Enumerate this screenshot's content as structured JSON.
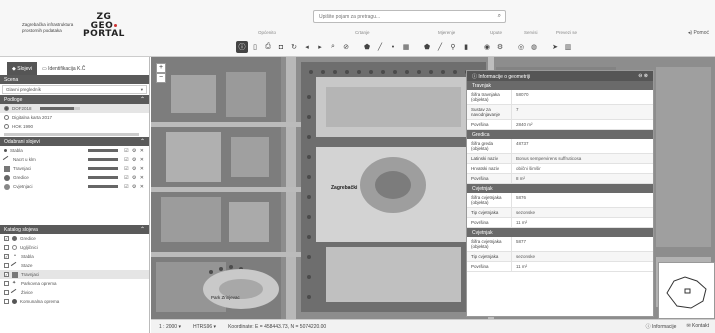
{
  "header": {
    "org_name": "Zagrebačka infrastruktura prostornih podataka",
    "logo_lines": [
      "ZG",
      "GEO",
      "PORTAL"
    ],
    "search_placeholder": "Upišite pojam za pretragu...",
    "toolbar_groups": [
      "Općenito",
      "Crtanje",
      "Mjerenje",
      "Upute",
      "Servisi",
      "Prevezi se"
    ],
    "help_label": "Pomoć"
  },
  "sidebar": {
    "tabs": [
      "Slojevi",
      "Identifikacija K.Č"
    ],
    "scale_section_title": "Scena",
    "scale_value": "Glavni pregledník",
    "basemap_section_title": "Podloge",
    "basemaps": [
      {
        "label": "DOF2018",
        "selected": true
      },
      {
        "label": "Digitalna karta 2017",
        "selected": false
      },
      {
        "label": "HOK 1990",
        "selected": false
      }
    ],
    "active_layers_title": "Odabrani slojevi",
    "active_layers": [
      {
        "label": "Stabla"
      },
      {
        "label": "Nacrt u klm"
      },
      {
        "label": "Travnjaci"
      },
      {
        "label": "Gredice"
      },
      {
        "label": "Cvjetnjaci"
      }
    ],
    "catalog_title": "Katalog slojeva",
    "catalog": [
      {
        "label": "Gredice",
        "checked": true
      },
      {
        "label": "Ugljičnici",
        "checked": false
      },
      {
        "label": "Stabla",
        "checked": true
      },
      {
        "label": "Staze",
        "checked": false
      },
      {
        "label": "Travnjaci",
        "checked": true
      },
      {
        "label": "Parkovna oprema",
        "checked": false
      },
      {
        "label": "Živice",
        "checked": false
      },
      {
        "label": "Komunalna oprema",
        "checked": false
      }
    ]
  },
  "map": {
    "labels": [
      "Zagrebački",
      "Park Zrinjevac"
    ]
  },
  "statusbar": {
    "scale": "1 : 2000",
    "crs": "HTRS96",
    "coords": "Koordinate: E = 458443.73, N = 5074220.00",
    "info": "Informacije",
    "contact": "Kontakt"
  },
  "info_panel": {
    "title": "Informacije o geometriji",
    "groups": [
      {
        "layer": "Travnjak",
        "rows": [
          {
            "k": "Šifra travnjaka (objekta)",
            "v": "58070"
          },
          {
            "k": "Sustav za navodnjavanje",
            "v": "7"
          },
          {
            "k": "Površina",
            "v": "2840 m²"
          }
        ]
      },
      {
        "layer": "Gredica",
        "rows": [
          {
            "k": "Šifra greda (objekta)",
            "v": "48737"
          },
          {
            "k": "Latinski naziv",
            "v": "Bonus sempervirens suffruticosa"
          },
          {
            "k": "Hrvatski naziv",
            "v": "obični šimšir"
          },
          {
            "k": "Površina",
            "v": "8 m²"
          }
        ]
      },
      {
        "layer": "Cvjetnjak",
        "rows": [
          {
            "k": "Šifra cvjetnjaka (objekta)",
            "v": "5876"
          },
          {
            "k": "Tip cvjetnjaka",
            "v": "sezonske"
          },
          {
            "k": "Površina",
            "v": "11 m²"
          }
        ]
      },
      {
        "layer": "Cvjetnjak",
        "rows": [
          {
            "k": "Šifra cvjetnjaka (objekta)",
            "v": "5877"
          },
          {
            "k": "Tip cvjetnjaka",
            "v": "sezonske"
          },
          {
            "k": "Površina",
            "v": "11 m²"
          }
        ]
      }
    ]
  }
}
